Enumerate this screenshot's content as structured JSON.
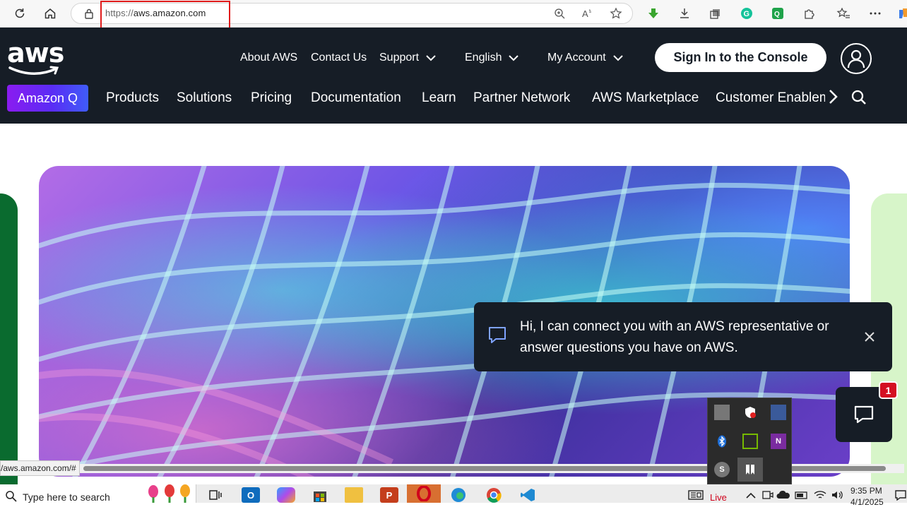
{
  "browser": {
    "url_scheme": "https://",
    "url_host": "aws.amazon.com"
  },
  "aws_header": {
    "logo_text": "aws",
    "top_links": {
      "about": "About AWS",
      "contact": "Contact Us",
      "support": "Support",
      "language": "English",
      "account": "My Account"
    },
    "sign_in_label": "Sign In to the Console",
    "amazon_q_label": "Amazon Q",
    "nav": {
      "products": "Products",
      "solutions": "Solutions",
      "pricing": "Pricing",
      "documentation": "Documentation",
      "learn": "Learn",
      "partner_network": "Partner Network",
      "marketplace": "AWS Marketplace",
      "customer_enablement": "Customer Enablement"
    }
  },
  "chat": {
    "message": "Hi, I can connect you with an AWS representative or answer questions you have on AWS.",
    "badge_count": "1"
  },
  "status_bar": {
    "hover_url": "/aws.amazon.com/#"
  },
  "taskbar": {
    "search_placeholder": "Type here to search",
    "live_label": "Live",
    "time": "9:35 PM",
    "date": "4/1/2025"
  },
  "colors": {
    "aws_navy": "#161d26",
    "sign_in_bg": "#ffffff",
    "amazon_q_gradient": [
      "#8a1cf0",
      "#3f5cf8"
    ],
    "url_highlight": "#e01b1b",
    "badge_red": "#d40f22"
  },
  "icons": {
    "toolbar": [
      "refresh-icon",
      "home-icon",
      "lock-icon",
      "zoom-icon",
      "read-aloud-icon",
      "favorite-star-icon",
      "download-arrow-icon",
      "downloads-icon",
      "collections-icon",
      "grammarly-icon",
      "extension-icon",
      "puzzle-icon",
      "favorites-icon",
      "more-icon"
    ],
    "header": [
      "chevron-down-icon",
      "user-avatar-icon",
      "chevron-right-icon",
      "search-icon"
    ],
    "chat": [
      "chat-bubble-icon",
      "close-icon"
    ]
  }
}
